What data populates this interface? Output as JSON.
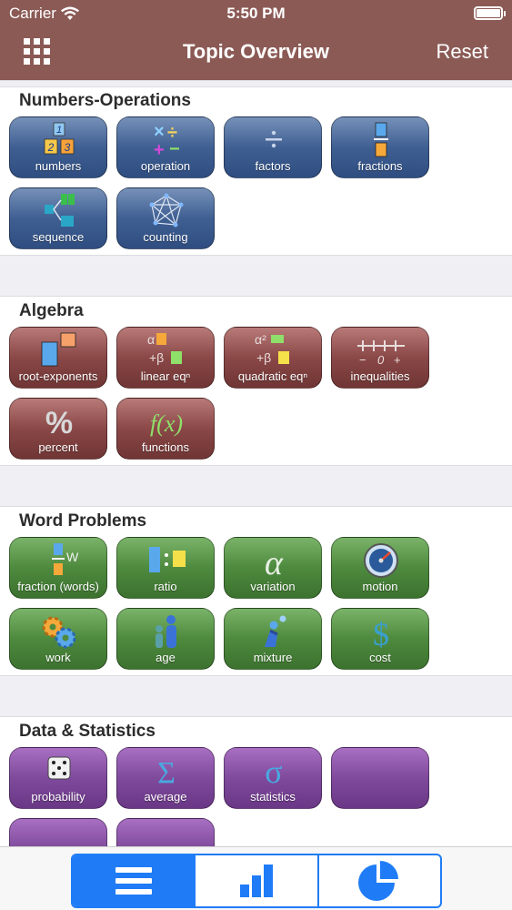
{
  "status_bar": {
    "carrier": "Carrier",
    "time": "5:50 PM"
  },
  "nav": {
    "title": "Topic Overview",
    "reset": "Reset"
  },
  "sections": [
    {
      "title": "Numbers-Operations",
      "tiles": [
        "numbers",
        "operation",
        "factors",
        "fractions",
        "sequence",
        "counting"
      ]
    },
    {
      "title": "Algebra",
      "tiles": [
        "root-exponents",
        "linear eqⁿ",
        "quadratic eqⁿ",
        "inequalities",
        "percent",
        "functions"
      ]
    },
    {
      "title": "Word Problems",
      "tiles": [
        "fraction (words)",
        "ratio",
        "variation",
        "motion",
        "work",
        "age",
        "mixture",
        "cost"
      ]
    },
    {
      "title": "Data & Statistics",
      "tiles": [
        "probability",
        "average",
        "statistics"
      ]
    }
  ],
  "colors": {
    "nav": "#8b5a55",
    "numbers": "#3f5f92",
    "algebra": "#8a4847",
    "word_problems": "#4e8a3e",
    "data": "#7f4a9c",
    "tab_accent": "#1f7cf6"
  },
  "tabs": [
    "list-icon",
    "bar-chart-icon",
    "pie-chart-icon"
  ]
}
